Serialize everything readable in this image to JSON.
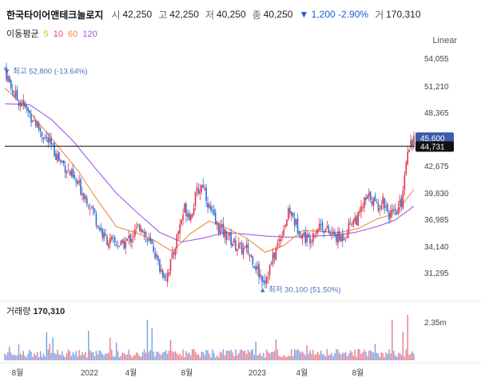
{
  "header": {
    "name": "한국타이어앤테크놀로지",
    "open_label": "시",
    "open": "42,250",
    "high_label": "고",
    "high": "42,250",
    "low_label": "저",
    "low": "40,250",
    "close_label": "종",
    "close": "40,250",
    "change": "▼ 1,200 -2.90%",
    "volume_label": "거",
    "volume": "170,310"
  },
  "ma_legend": {
    "title": "이동평균",
    "items": [
      {
        "label": "5",
        "color": "#d8c000"
      },
      {
        "label": "10",
        "color": "#e0465a"
      },
      {
        "label": "60",
        "color": "#f08a3c"
      },
      {
        "label": "120",
        "color": "#a05ae6"
      }
    ]
  },
  "scale_mode": "Linear",
  "volume_panel": {
    "label": "거래량",
    "value": "170,310",
    "axis_label": "2.35m"
  },
  "chart_data": {
    "type": "candlestick",
    "y_ticks": [
      54055,
      51210,
      48365,
      45520,
      42675,
      39830,
      36985,
      34140,
      31295
    ],
    "y_tick_labels": [
      "54,055",
      "51,210",
      "48,365",
      "45,520",
      "42,675",
      "39,830",
      "36,985",
      "34,140",
      "31,295"
    ],
    "x_ticks": [
      "8월",
      "2022",
      "4월",
      "8월",
      "2023",
      "4월",
      "8월"
    ],
    "last_price": {
      "value": 45600,
      "label": "45,600"
    },
    "crosshair": {
      "value": 44731,
      "label": "44,731"
    },
    "high_annotation": {
      "value": 52800,
      "label": "최고 52,800 (-13.64%)"
    },
    "low_annotation": {
      "value": 30100,
      "label": "최저 30,100 (51.50%)"
    },
    "price_path": [
      [
        0,
        53000
      ],
      [
        4,
        51000
      ],
      [
        8,
        49800
      ],
      [
        12,
        49200
      ],
      [
        16,
        48200
      ],
      [
        20,
        47200
      ],
      [
        24,
        46100
      ],
      [
        28,
        45200
      ],
      [
        32,
        44200
      ],
      [
        36,
        43200
      ],
      [
        40,
        42400
      ],
      [
        44,
        41300
      ],
      [
        48,
        40500
      ],
      [
        52,
        39500
      ],
      [
        56,
        38300
      ],
      [
        60,
        36500
      ],
      [
        64,
        35100
      ],
      [
        68,
        34600
      ],
      [
        72,
        34400
      ],
      [
        76,
        34200
      ],
      [
        80,
        34900
      ],
      [
        84,
        35600
      ],
      [
        88,
        36500
      ],
      [
        92,
        34700
      ],
      [
        96,
        33900
      ],
      [
        100,
        31800
      ],
      [
        104,
        30900
      ],
      [
        108,
        32800
      ],
      [
        112,
        35800
      ],
      [
        116,
        38200
      ],
      [
        120,
        37400
      ],
      [
        124,
        39900
      ],
      [
        128,
        40800
      ],
      [
        132,
        38200
      ],
      [
        136,
        36500
      ],
      [
        140,
        35800
      ],
      [
        144,
        35200
      ],
      [
        148,
        34400
      ],
      [
        152,
        33900
      ],
      [
        156,
        33700
      ],
      [
        160,
        32800
      ],
      [
        164,
        31200
      ],
      [
        168,
        30600
      ],
      [
        172,
        32300
      ],
      [
        176,
        34300
      ],
      [
        180,
        36200
      ],
      [
        184,
        37900
      ],
      [
        188,
        36400
      ],
      [
        192,
        35400
      ],
      [
        196,
        34800
      ],
      [
        200,
        35900
      ],
      [
        204,
        36500
      ],
      [
        208,
        35700
      ],
      [
        212,
        35300
      ],
      [
        216,
        34900
      ],
      [
        220,
        35600
      ],
      [
        224,
        36900
      ],
      [
        228,
        37100
      ],
      [
        232,
        38800
      ],
      [
        236,
        39500
      ],
      [
        240,
        38300
      ],
      [
        244,
        39100
      ],
      [
        248,
        37600
      ],
      [
        252,
        37300
      ],
      [
        256,
        38900
      ],
      [
        260,
        44700
      ],
      [
        264,
        45600
      ]
    ],
    "ma60_path": [
      [
        0,
        51000
      ],
      [
        12,
        49200
      ],
      [
        24,
        46800
      ],
      [
        36,
        44400
      ],
      [
        48,
        42000
      ],
      [
        60,
        39000
      ],
      [
        72,
        36200
      ],
      [
        84,
        35600
      ],
      [
        96,
        34800
      ],
      [
        108,
        33600
      ],
      [
        120,
        35500
      ],
      [
        132,
        36800
      ],
      [
        144,
        36000
      ],
      [
        156,
        35000
      ],
      [
        168,
        33500
      ],
      [
        180,
        34200
      ],
      [
        192,
        35800
      ],
      [
        204,
        35700
      ],
      [
        216,
        35600
      ],
      [
        228,
        36000
      ],
      [
        240,
        37000
      ],
      [
        252,
        37600
      ],
      [
        264,
        40200
      ]
    ],
    "ma120_path": [
      [
        0,
        49300
      ],
      [
        16,
        49200
      ],
      [
        30,
        47600
      ],
      [
        44,
        45300
      ],
      [
        58,
        42500
      ],
      [
        72,
        39800
      ],
      [
        86,
        37600
      ],
      [
        100,
        35600
      ],
      [
        114,
        34600
      ],
      [
        128,
        35000
      ],
      [
        142,
        35600
      ],
      [
        156,
        35400
      ],
      [
        170,
        35200
      ],
      [
        184,
        35100
      ],
      [
        198,
        35200
      ],
      [
        212,
        35300
      ],
      [
        226,
        35600
      ],
      [
        240,
        36200
      ],
      [
        252,
        36900
      ],
      [
        264,
        38400
      ]
    ],
    "volume_ylim": [
      0,
      2350000
    ]
  }
}
